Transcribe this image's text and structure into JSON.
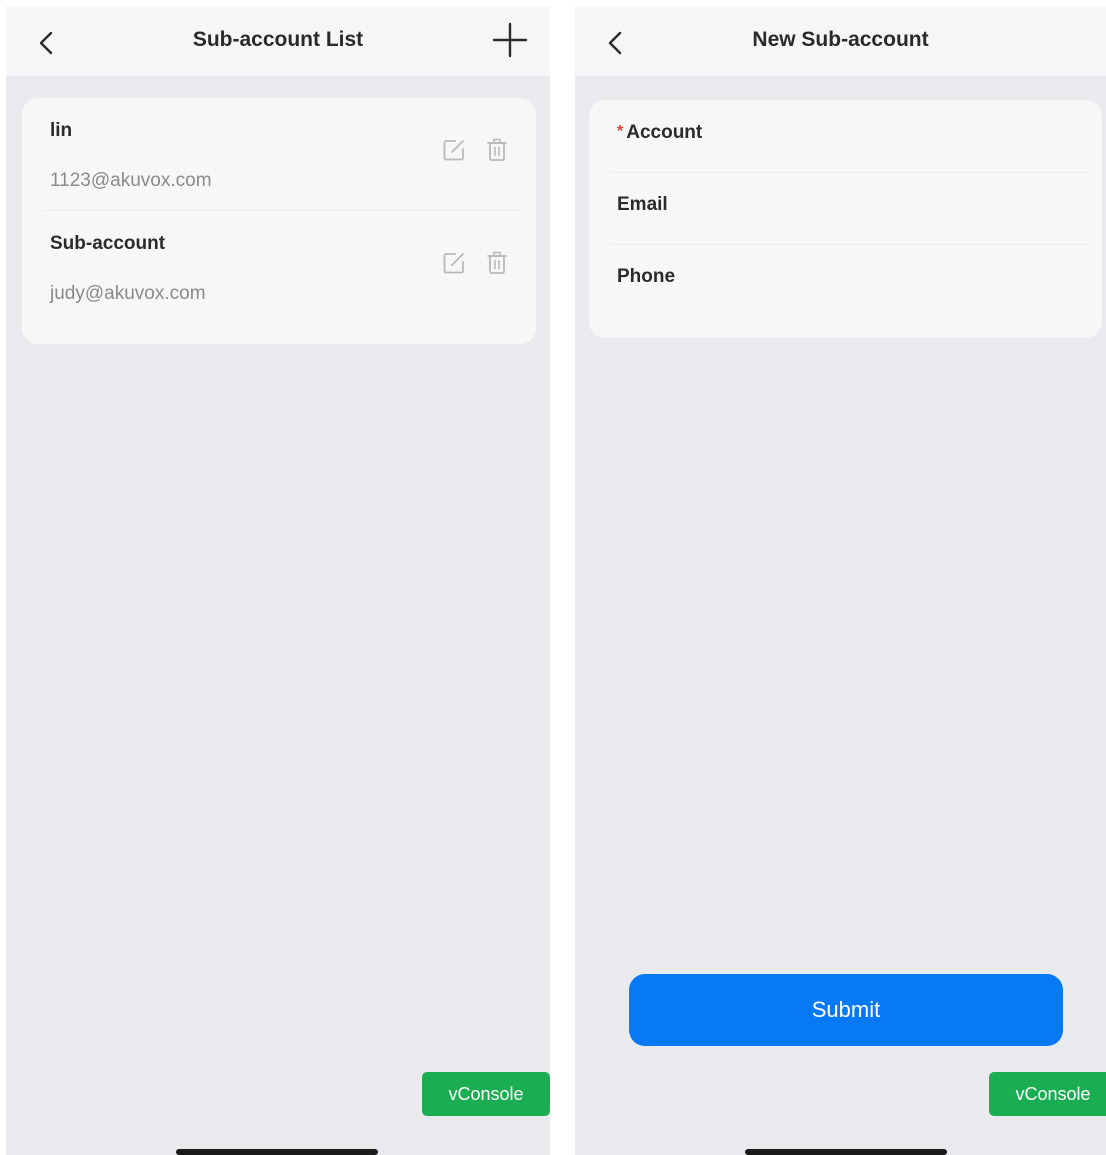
{
  "list_screen": {
    "title": "Sub-account List",
    "accounts": [
      {
        "name": "lin",
        "email": "1123@akuvox.com"
      },
      {
        "name": "Sub-account",
        "email": "judy@akuvox.com"
      }
    ],
    "vconsole_label": "vConsole"
  },
  "new_screen": {
    "title": "New Sub-account",
    "fields": {
      "account": {
        "label": "Account",
        "required_mark": "*"
      },
      "email": {
        "label": "Email"
      },
      "phone": {
        "label": "Phone"
      }
    },
    "submit_label": "Submit",
    "vconsole_label": "vConsole"
  },
  "colors": {
    "accent": "#0879f5",
    "vconsole": "#1aad52",
    "required": "#e0403a",
    "background": "#e9eaee"
  },
  "icons": [
    "back-icon",
    "plus-icon",
    "edit-icon",
    "trash-icon"
  ]
}
